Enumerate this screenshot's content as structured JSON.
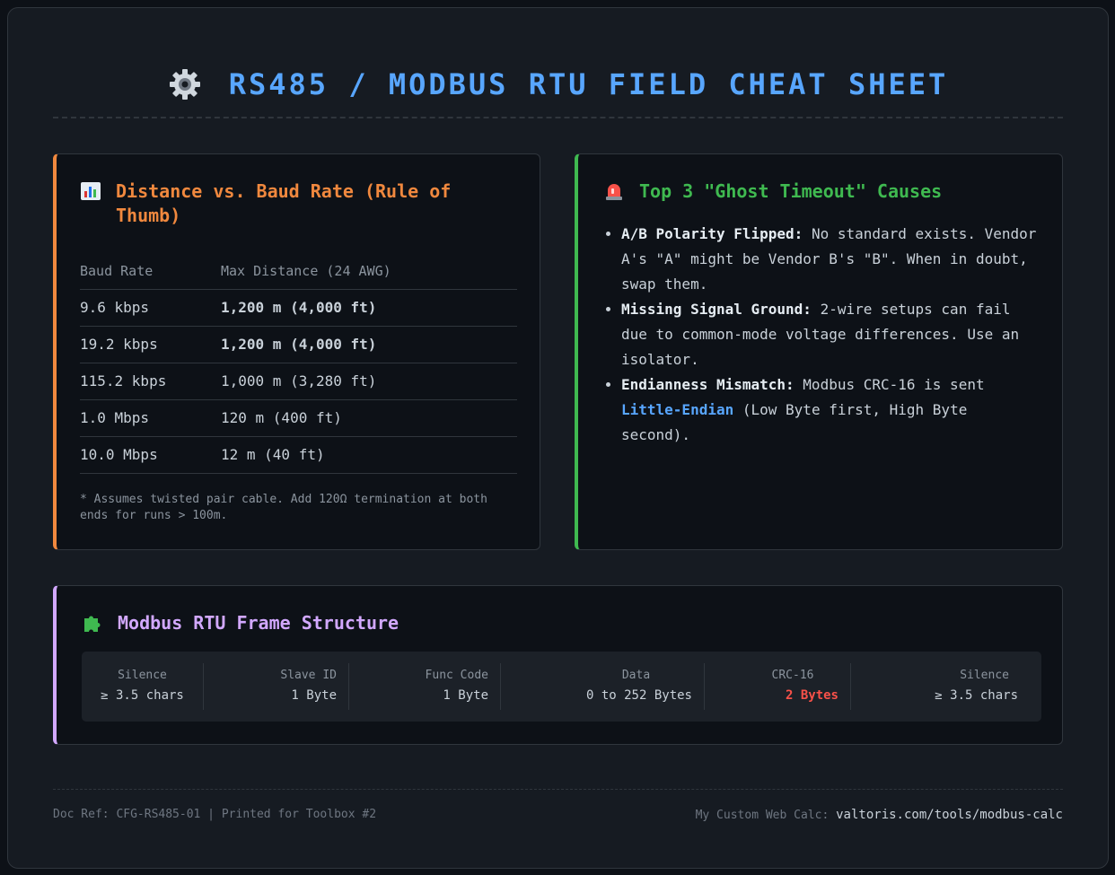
{
  "header": {
    "title": "RS485 / MODBUS RTU FIELD CHEAT SHEET",
    "icon": "gear-icon"
  },
  "baud_card": {
    "title": "Distance vs. Baud Rate (Rule of Thumb)",
    "icon": "bar-chart-icon",
    "columns": [
      "Baud Rate",
      "Max Distance (24 AWG)"
    ],
    "rows": [
      {
        "rate": "9.6 kbps",
        "distance": "1,200 m (4,000 ft)",
        "level": "good"
      },
      {
        "rate": "19.2 kbps",
        "distance": "1,200 m (4,000 ft)",
        "level": "good"
      },
      {
        "rate": "115.2 kbps",
        "distance": "1,000 m (3,280 ft)",
        "level": "ok"
      },
      {
        "rate": "1.0 Mbps",
        "distance": "120 m (400 ft)",
        "level": "bad"
      },
      {
        "rate": "10.0 Mbps",
        "distance": "12 m (40 ft)",
        "level": "bad"
      }
    ],
    "footnote": "* Assumes twisted pair cable. Add 120Ω termination at both ends for runs > 100m."
  },
  "causes_card": {
    "title": "Top 3 \"Ghost Timeout\" Causes",
    "icon": "siren-icon",
    "items": [
      {
        "label": "A/B Polarity Flipped:",
        "text": "No standard exists. Vendor A's \"A\" might be Vendor B's \"B\". When in doubt, swap them."
      },
      {
        "label": "Missing Signal Ground:",
        "text": "2-wire setups can fail due to common-mode voltage differences. Use an isolator."
      },
      {
        "label": "Endianness Mismatch:",
        "text_before": "Modbus CRC-16 is sent",
        "highlight": "Little-Endian",
        "text_after": "(Low Byte first, High Byte second)."
      }
    ]
  },
  "frame_card": {
    "title": "Modbus RTU Frame Structure",
    "icon": "puzzle-icon",
    "segments": [
      {
        "name": "Silence",
        "value": "≥ 3.5 chars"
      },
      {
        "name": "Slave ID",
        "value": "1 Byte"
      },
      {
        "name": "Func Code",
        "value": "1 Byte"
      },
      {
        "name": "Data",
        "value": "0 to 252 Bytes"
      },
      {
        "name": "CRC-16",
        "value": "2 Bytes"
      },
      {
        "name": "Silence",
        "value": "≥ 3.5 chars"
      }
    ]
  },
  "footer": {
    "left": "Doc Ref: CFG-RS485-01 | Printed for Toolbox #2",
    "right_label": "My Custom Web Calc:",
    "right_url": "valtoris.com/tools/modbus-calc"
  },
  "colors": {
    "accent_blue": "#58a6ff",
    "orange": "#f0883e",
    "green": "#3fb950",
    "purple": "#d2a8ff",
    "red": "#f85149"
  }
}
